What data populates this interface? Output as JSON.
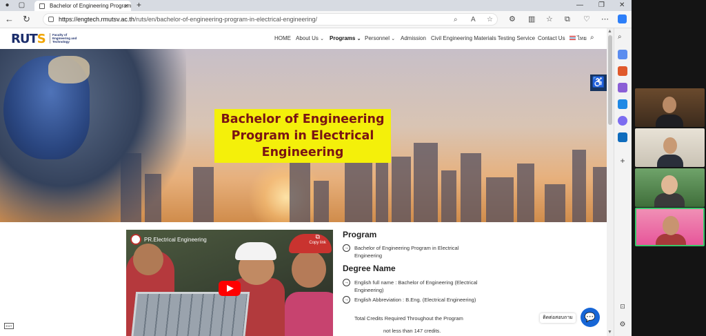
{
  "browser": {
    "tab_title": "Bachelor of Engineering Program",
    "tab_close": "×",
    "new_tab": "+",
    "url_host": "https://engtech.rmutsv.ac.th",
    "url_path": "/ruts/en/bachelor-of-engineering-program-in-electrical-engineering/"
  },
  "site": {
    "logo_main": "RUT",
    "logo_s": "S",
    "logo_faculty": "Faculty of Engineering and Technology",
    "menu": {
      "home": "HOME",
      "about": "About Us",
      "programs": "Programs",
      "personnel": "Personnel",
      "admission": "Admission",
      "testing": "Civil Engineering Materials Testing Service",
      "contact": "Contact Us",
      "lang": "ไทย"
    }
  },
  "hero": {
    "title_line1": "Bachelor of Engineering",
    "title_line2": "Program in Electrical",
    "title_line3": "Engineering"
  },
  "video": {
    "title": "PR.Electrical Engineering",
    "copy_link": "Copy link"
  },
  "program": {
    "heading": "Program",
    "item1": "Bachelor of Engineering Program in Electrical Engineering",
    "degree_heading": "Degree Name",
    "full_name": "English full name : Bachelor of Engineering (Electrical Engineering)",
    "abbreviation": "English Abbreviation : B.Eng. (Electrical Engineering)",
    "credits_label": "Total Credits Required Throughout the Program",
    "credits_value": "not less than 147 credits."
  },
  "chat": {
    "label": "ติดต่อสอบถาม"
  },
  "exit_label": "EXIT",
  "colors": {
    "title_bg": "#f4f00a",
    "title_text": "#7a1414",
    "navy": "#1b2d6b",
    "chat": "#1766d6"
  }
}
